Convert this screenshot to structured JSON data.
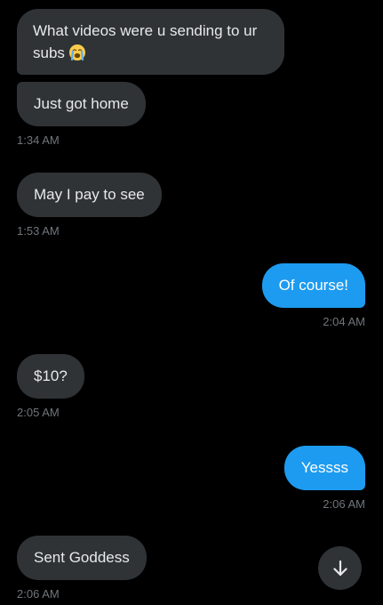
{
  "messages": [
    {
      "direction": "received",
      "text": "What videos were u sending to ur subs",
      "emoji": "loudly-crying-face-icon"
    },
    {
      "direction": "received",
      "text": "Just got home",
      "time": "1:34 AM"
    },
    {
      "direction": "received",
      "text": "May I pay to see",
      "time": "1:53 AM"
    },
    {
      "direction": "sent",
      "text": "Of course!",
      "time": "2:04 AM"
    },
    {
      "direction": "received",
      "text": "$10?",
      "time": "2:05 AM"
    },
    {
      "direction": "sent",
      "text": "Yessss",
      "time": "2:06 AM"
    },
    {
      "direction": "received",
      "text": "Sent Goddess",
      "time": "2:06 AM"
    }
  ],
  "scroll_button": {
    "icon": "arrow-down-icon"
  },
  "colors": {
    "background": "#000000",
    "received_bubble": "#2f3336",
    "sent_bubble": "#1d9bf0",
    "message_text": "#e7e9ea",
    "timestamp": "#71767b"
  }
}
